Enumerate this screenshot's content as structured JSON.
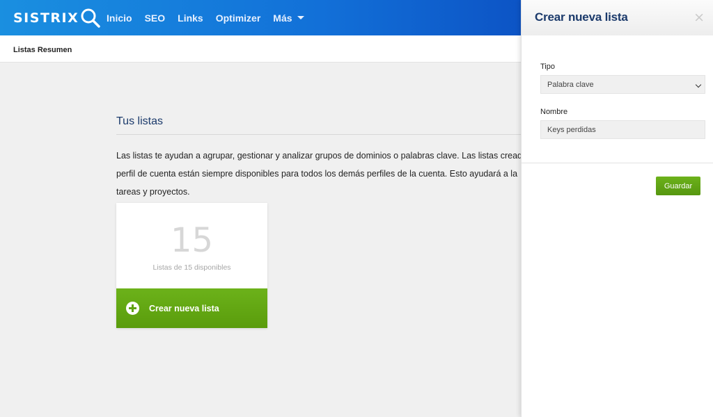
{
  "header": {
    "logo_text": "SISTRIX",
    "nav": [
      "Inicio",
      "SEO",
      "Links",
      "Optimizer",
      "Más"
    ]
  },
  "breadcrumb": "Listas Resumen",
  "main": {
    "title": "Tus listas",
    "intro_lines": [
      "Las listas te ayudan a agrupar, gestionar y analizar grupos de dominios o palabras clave. Las listas creadas",
      "perfil de cuenta están siempre disponibles para todos los demás perfiles de la cuenta. Esto ayudará a la",
      "tareas y proyectos."
    ],
    "card": {
      "count": "15",
      "subtitle": "Listas de 15 disponibles",
      "button_label": "Crear nueva lista"
    }
  },
  "panel": {
    "title": "Crear nueva lista",
    "close_symbol": "×",
    "tipo_label": "Tipo",
    "tipo_value": "Palabra clave",
    "nombre_label": "Nombre",
    "nombre_value": "Keys perdidas",
    "save_label": "Guardar"
  },
  "colors": {
    "header_start": "#1a8fe0",
    "header_end": "#0a45b8",
    "accent_green": "#5fa311",
    "title_blue": "#1b3a6b"
  },
  "icons": {
    "logo": "magnifier-icon",
    "dropdown": "caret-down-icon",
    "add": "plus-circle-icon",
    "close": "close-icon"
  }
}
